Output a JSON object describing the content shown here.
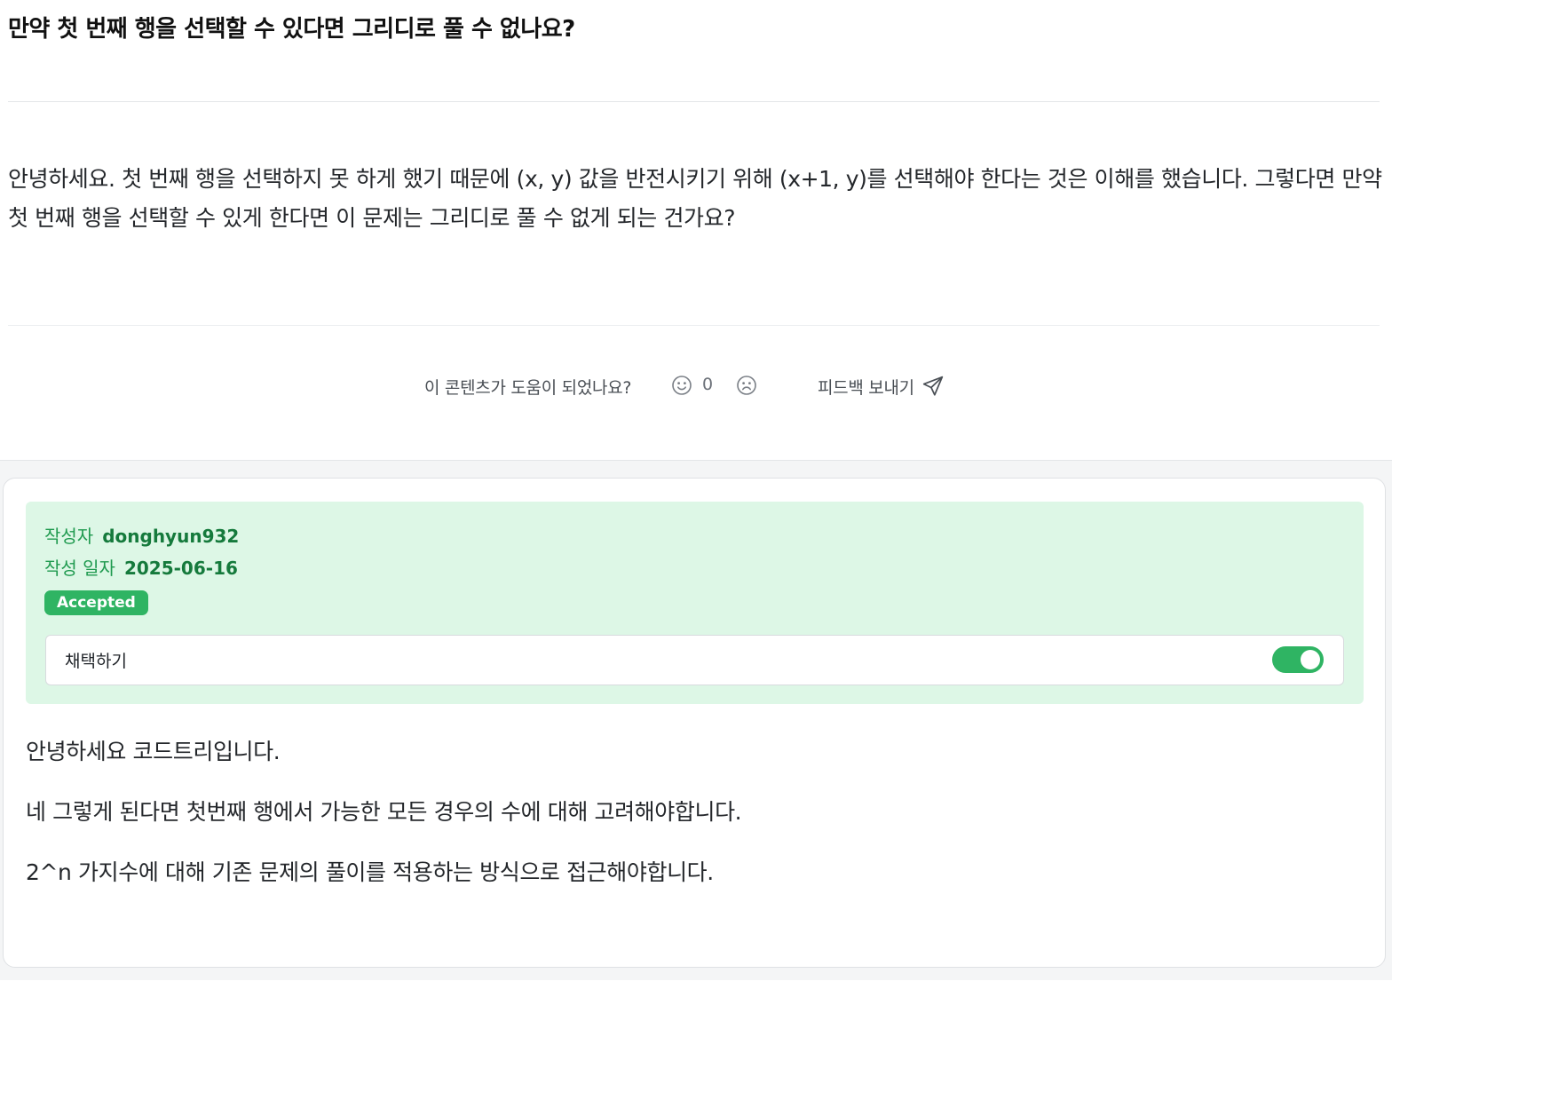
{
  "question": {
    "title": "만약 첫 번째 행을 선택할 수 있다면 그리디로 풀 수 없나요?",
    "body": "안녕하세요. 첫 번째 행을 선택하지 못 하게 했기 때문에 (x, y) 값을 반전시키기 위해 (x+1, y)를 선택해야 한다는 것은 이해를 했습니다. 그렇다면 만약 첫 번째 행을 선택할 수 있게 한다면 이 문제는 그리디로 풀 수 없게 되는 건가요?"
  },
  "feedback": {
    "question": "이 콘텐츠가 도움이 되었나요?",
    "like_icon": "smile-icon",
    "like_count": "0",
    "dislike_icon": "frown-icon",
    "send_label": "피드백 보내기",
    "send_icon": "paper-plane-icon"
  },
  "answer": {
    "author_key": "작성자",
    "author": "donghyun932",
    "date_key": "작성 일자",
    "date": "2025-06-16",
    "status_badge": "Accepted",
    "accept_label": "채택하기",
    "accept_toggle_on": true,
    "paragraphs": [
      "안녕하세요 코드트리입니다.",
      "네 그렇게 된다면 첫번째 행에서 가능한 모든 경우의 수에 대해 고려해야합니다.",
      "2^n 가지수에 대해 기존 문제의 풀이를 적용하는 방식으로 접근해야합니다."
    ]
  },
  "colors": {
    "accent_green": "#2fb463",
    "meta_bg": "#ddf7e6",
    "meta_text": "#157a3c"
  }
}
